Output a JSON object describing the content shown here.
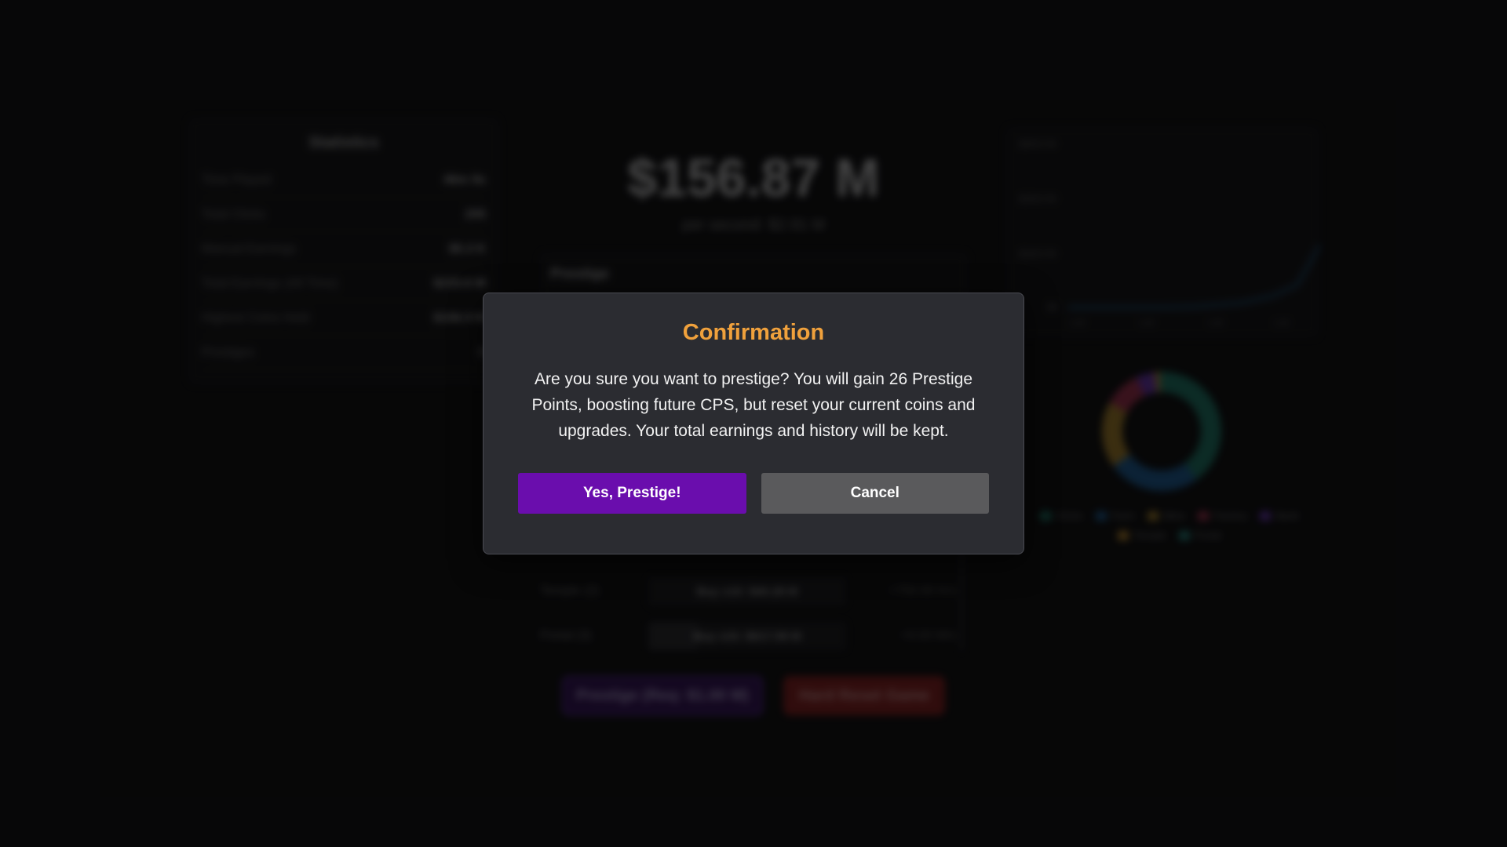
{
  "background": {
    "stats": {
      "title": "Statistics",
      "rows": [
        {
          "label": "Time Played",
          "value": "46m 9s"
        },
        {
          "label": "Total Clicks",
          "value": "205"
        },
        {
          "label": "Manual Earnings",
          "value": "$5.3 K"
        },
        {
          "label": "Total Earnings (All Time)",
          "value": "$233.6 M"
        },
        {
          "label": "Highest Coins Held",
          "value": "$156.9 M"
        },
        {
          "label": "Prestiges",
          "value": "0"
        }
      ]
    },
    "coins": "$156.87 M",
    "per_second": "per second: $2.91 M",
    "prestige_title": "Prestige",
    "generators": [
      {
        "name": "Temple (2)",
        "buy": "Buy x10: $40.28 M",
        "rate": "+750.00 K/s",
        "progress": 0
      },
      {
        "name": "Portal (3)",
        "buy": "Buy x10: $617.59 M",
        "rate": "+9.00 M/s",
        "progress": 0.25
      }
    ],
    "prestige_button": "Prestige (Req: $1.00 M)",
    "reset_button": "Hard Reset Game",
    "line_chart": {
      "y_ticks": [
        "$200.0 M",
        "$150.0 M",
        "$100.0 M",
        "$0"
      ],
      "x_ticks": [
        "1:00",
        "1:00",
        "1:00",
        "1:00"
      ],
      "line_color": "#1f6fb0"
    },
    "donut": {
      "segments": [
        {
          "name": "Clicks",
          "value": 40,
          "color": "#1f8f7a"
        },
        {
          "name": "Farm",
          "value": 25,
          "color": "#1e6fb5"
        },
        {
          "name": "Mine",
          "value": 18,
          "color": "#c99a2e"
        },
        {
          "name": "Factory",
          "value": 10,
          "color": "#c2365a"
        },
        {
          "name": "Bank",
          "value": 5,
          "color": "#7a3bd6"
        },
        {
          "name": "Temple",
          "value": 1.5,
          "color": "#e0a030"
        },
        {
          "name": "Portal",
          "value": 0.5,
          "color": "#2aa198"
        }
      ]
    }
  },
  "modal": {
    "title": "Confirmation",
    "message": "Are you sure you want to prestige? You will gain 26 Prestige Points, boosting future CPS, but reset your current coins and upgrades. Your total earnings and history will be kept.",
    "confirm_label": "Yes, Prestige!",
    "cancel_label": "Cancel",
    "title_color": "#f0a13c",
    "confirm_color": "#6a0dad",
    "cancel_color": "#5a5a5c"
  }
}
